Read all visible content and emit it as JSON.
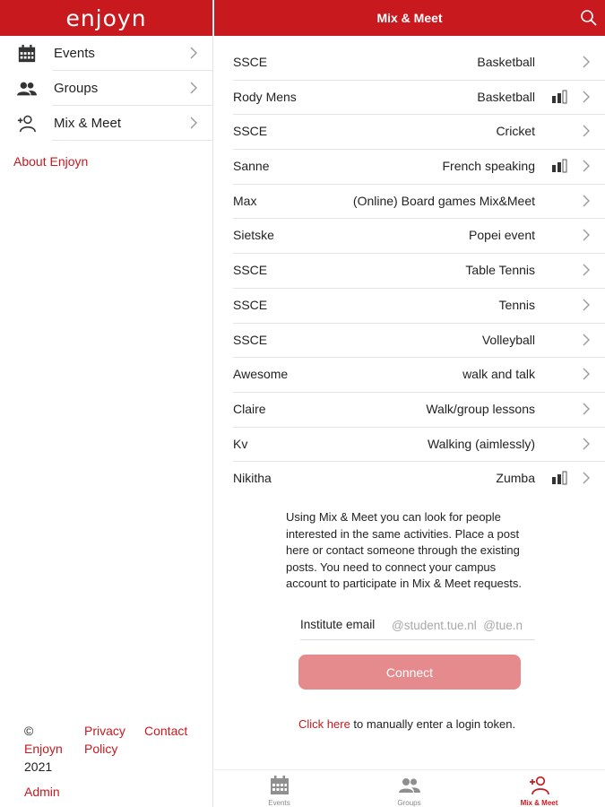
{
  "app": {
    "logo": "enjoyn",
    "title": "Mix & Meet"
  },
  "colors": {
    "brand": "#c8191f",
    "button_disabled": "#e58a8d"
  },
  "sidebar": {
    "items": [
      {
        "label": "Events",
        "icon": "calendar-icon"
      },
      {
        "label": "Groups",
        "icon": "people-icon"
      },
      {
        "label": "Mix & Meet",
        "icon": "add-person-icon"
      }
    ],
    "about_link": "About Enjoyn",
    "footer": {
      "copyright_symbol": "©",
      "brand": "Enjoyn",
      "year": "2021",
      "privacy_line1": "Privacy",
      "privacy_line2": "Policy",
      "contact": "Contact",
      "admin": "Admin"
    }
  },
  "posts": [
    {
      "name": "SSCE",
      "activity": "Basketball",
      "signal": false
    },
    {
      "name": "Rody Mens",
      "activity": "Basketball",
      "signal": true
    },
    {
      "name": "SSCE",
      "activity": "Cricket",
      "signal": false
    },
    {
      "name": "Sanne",
      "activity": "French speaking",
      "signal": true
    },
    {
      "name": "Max",
      "activity": "(Online) Board games Mix&Meet",
      "signal": false
    },
    {
      "name": "Sietske",
      "activity": "Popei event",
      "signal": false
    },
    {
      "name": "SSCE",
      "activity": "Table Tennis",
      "signal": false
    },
    {
      "name": "SSCE",
      "activity": "Tennis",
      "signal": false
    },
    {
      "name": "SSCE",
      "activity": "Volleyball",
      "signal": false
    },
    {
      "name": "Awesome",
      "activity": "walk and talk",
      "signal": false
    },
    {
      "name": "Claire",
      "activity": "Walk/group lessons",
      "signal": false
    },
    {
      "name": "Kv",
      "activity": "Walking (aimlessly)",
      "signal": false
    },
    {
      "name": "Nikitha",
      "activity": "Zumba",
      "signal": true
    }
  ],
  "info_text": "Using Mix & Meet you can look for people interested in the same activities. Place a post here or contact someone through the existing posts. You need to connect your campus account to participate in Mix & Meet requests.",
  "email": {
    "label": "Institute email",
    "placeholder": "@student.tue.nl  @tue.nl",
    "value": ""
  },
  "connect_label": "Connect",
  "token_note": {
    "link": "Click here",
    "rest": " to manually enter a login token."
  },
  "tabs": [
    {
      "label": "Events",
      "icon": "calendar-icon",
      "active": false
    },
    {
      "label": "Groups",
      "icon": "people-icon",
      "active": false
    },
    {
      "label": "Mix & Meet",
      "icon": "add-person-icon",
      "active": true
    }
  ]
}
